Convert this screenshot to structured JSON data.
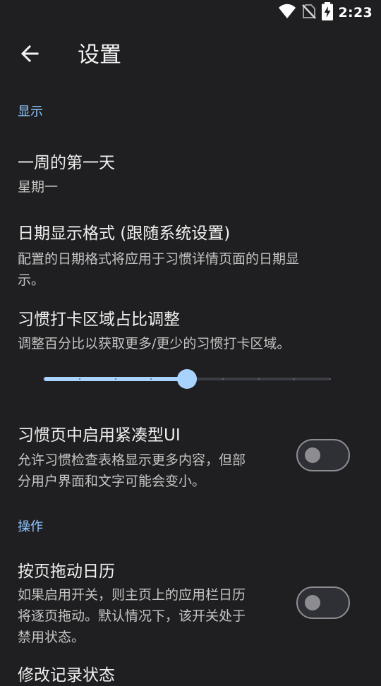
{
  "status_bar": {
    "time": "2:23",
    "icons": [
      "wifi-icon",
      "no-sim-icon",
      "battery-charging-icon"
    ]
  },
  "app_bar": {
    "back_icon": "arrow-left-icon",
    "title": "设置"
  },
  "sections": {
    "display": {
      "header": "显示",
      "first_day": {
        "title": "一周的第一天",
        "summary": "星期一"
      },
      "date_format": {
        "title": "日期显示格式 (跟随系统设置)",
        "summary_line1": "配置的日期格式将应用于习惯详情页面的日期显",
        "summary_line2": "示。"
      },
      "checkmark_ratio": {
        "title": "习惯打卡区域占比调整",
        "summary": "调整百分比以获取更多/更少的习惯打卡区域。",
        "slider_steps": 8,
        "slider_value_step": 4
      },
      "compact_ui": {
        "title": "习惯页中启用紧凑型UI",
        "summary_line1": "允许习惯检查表格显示更多内容，但部",
        "summary_line2": "分用户界面和文字可能会变小。",
        "enabled": false
      }
    },
    "actions": {
      "header": "操作",
      "page_scroll": {
        "title": "按页拖动日历",
        "summary_line1": "如果启用开关，则主页上的应用栏日历",
        "summary_line2": "将逐页拖动。默认情况下，该开关处于",
        "summary_line3": "禁用状态。",
        "enabled": false
      },
      "edit_record": {
        "title": "修改记录状态"
      }
    }
  },
  "colors": {
    "background": "#1f1f21",
    "accent": "#a9d3ff",
    "section_header": "#8fc6ff",
    "switch_off": "#8d8d91"
  }
}
